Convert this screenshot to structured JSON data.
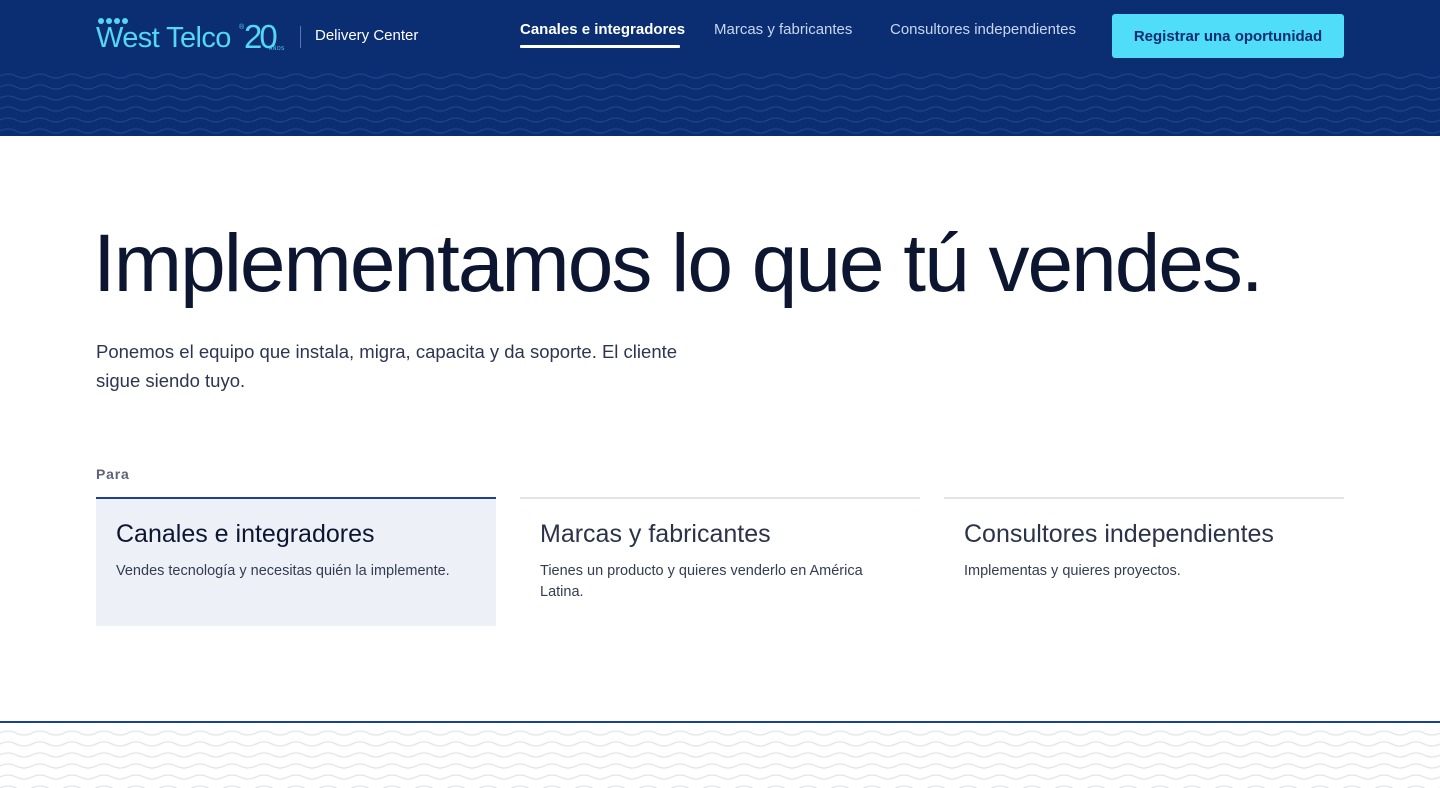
{
  "header": {
    "logo": {
      "brand": "West Telco",
      "reg": "®",
      "anniversary": "20",
      "anniversary_small": "AÑOS"
    },
    "section": "Delivery Center",
    "nav": [
      {
        "label": "Canales e integradores",
        "active": true
      },
      {
        "label": "Marcas y fabricantes",
        "active": false
      },
      {
        "label": "Consultores independientes",
        "active": false
      }
    ],
    "cta_label": "Registrar una oportunidad"
  },
  "hero": {
    "title": "Implementamos lo que tú vendes.",
    "subtitle": "Ponemos el equipo que instala, migra, capacita y da soporte. El cliente sigue siendo tuyo."
  },
  "audience": {
    "label": "Para",
    "cards": [
      {
        "title": "Canales e integradores",
        "description": "Vendes tecnología y necesitas quién la implemente.",
        "active": true
      },
      {
        "title": "Marcas y fabricantes",
        "description": "Tienes un producto y quieres venderlo en América Latina.",
        "active": false
      },
      {
        "title": "Consultores independientes",
        "description": "Implementas y quieres proyectos.",
        "active": false
      }
    ]
  },
  "colors": {
    "header_bg": "#0b2d72",
    "accent_cyan": "#4fddf9",
    "active_card_bg": "#edf0f7",
    "active_border": "#1b3f93",
    "wave_dark": "#1d4389",
    "wave_light": "#e3e5ea"
  }
}
